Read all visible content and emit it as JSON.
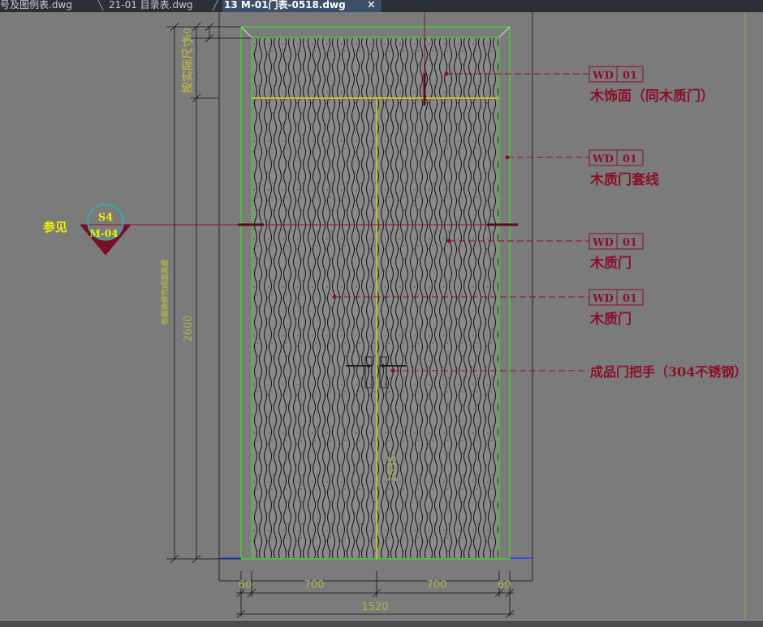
{
  "tabs": [
    {
      "label": "号及图例表.dwg",
      "active": false
    },
    {
      "label": "21-01 目录表.dwg",
      "active": false
    },
    {
      "label": "13 M-01门表-0518.dwg",
      "active": true
    }
  ],
  "tab_close_glyph": "✕",
  "drawing": {
    "annotations": [
      {
        "code": "WD",
        "num": "01",
        "desc": "木饰面（同木质门）"
      },
      {
        "code": "WD",
        "num": "01",
        "desc": "木质门套线"
      },
      {
        "code": "WD",
        "num": "01",
        "desc": "木质门"
      },
      {
        "code": "WD",
        "num": "01",
        "desc": "木质门"
      }
    ],
    "handle_label": "成品门把手（304不锈钢）",
    "section_ref": {
      "label": "参见",
      "top": "S4",
      "bottom": "M-04"
    },
    "vertical_labels": {
      "top_dim": "60",
      "transom": "按实际尺寸",
      "height_dim": "2600",
      "finish_floor": "依据装修完成面高度",
      "mid_dim": "1035"
    },
    "bottom_dims": [
      "60",
      "700",
      "700",
      "60"
    ],
    "total_width": "1520"
  },
  "colors": {
    "background": "#7b7b7b",
    "leader": "#8b0f2c",
    "frame_green": "#33e61a",
    "centerline_yellow": "#e6e600",
    "dim_text": "#b0b050",
    "hatch": "#111111"
  }
}
